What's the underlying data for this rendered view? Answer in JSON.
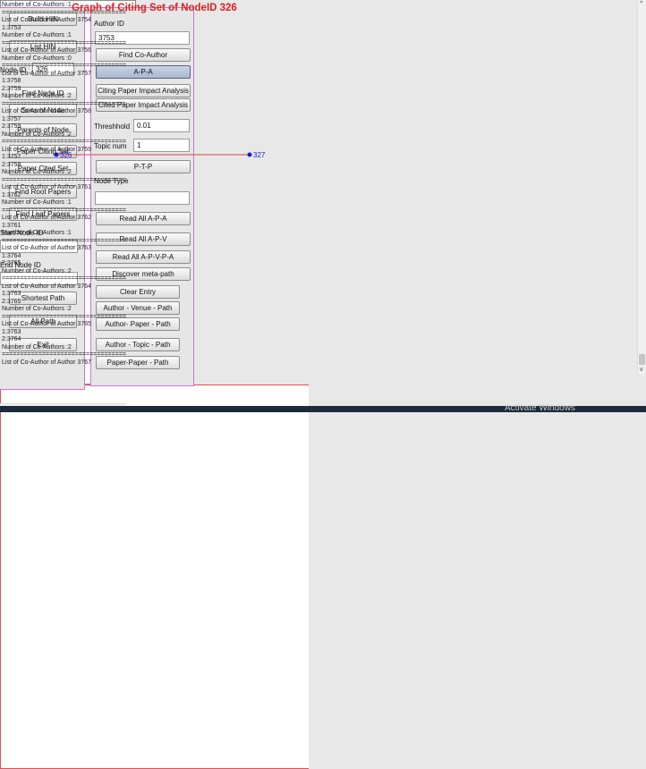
{
  "left_panel": {
    "build_hin": "Build HIN",
    "list_hin": "List HIN",
    "node_id_label": "Node ID",
    "node_id_value": "326",
    "find_node_id": "Find Node ID",
    "sons_of_node": "Sons  of Node",
    "parents_of_node": "Parents of Node",
    "paper_citing_set": "Paper Citing Set",
    "paper_cited_set": "Paper Cited Set",
    "find_root_papers": "Find Root Papers",
    "find_leaf_papers": "Find Leaf Papers",
    "start_node_id_label": "Start Node ID",
    "start_node_id_value": "",
    "end_node_id_label": "End Node ID",
    "end_node_id_value": "",
    "shortest_path": "Shortest Path",
    "all_path": "All Path",
    "exit": "Exit"
  },
  "mid_panel": {
    "author_id_label": "Author ID",
    "author_id_value": "3753",
    "find_co_author": "Find Co-Author",
    "apa": "A-P-A",
    "citing_paper_impact": "Citing Paper Impact Analysis",
    "cited_paper_impact": "Cited Paper Impact Analysis",
    "threshold_label": "Threshhold",
    "threshold_value": "0.01",
    "topic_num_label": "Topic num",
    "topic_num_value": "1",
    "ptp": "P-T-P",
    "node_type_label": "Node Type",
    "node_type_value": "",
    "read_all_apa": "Read All A-P-A",
    "read_all_apv": "Read All A-P-V",
    "read_all_apvpa": "Read All A-P-V-P-A",
    "discover_meta_path": "Discover meta-path",
    "clear_entry": "Clear Entry",
    "author_venue_path": "Author - Venue - Path",
    "author_paper_path": "Author- Paper - Path",
    "author_topic_path": "Author - Topic - Path",
    "paper_paper_path": "Paper-Paper - Path"
  },
  "output_list": {
    "lines": [
      "Number of Co-Authors :1",
      "======================================",
      "List of Co-Author of Author 3754",
      "1:3753",
      "Number of Co-Authors :1",
      "======================================",
      "List of Co-Author of Author 3756",
      "Number of Co-Authors :0",
      "======================================",
      "List of Co-Author of Author 3757",
      "1:3758",
      "2:3759",
      "Number of Co-Authors :2",
      "======================================",
      "List of Co-Author of Author 3758",
      "1:3757",
      "2:3759",
      "Number of Co-Authors :2",
      "======================================",
      "List of Co-Author of Author 3759",
      "1:3757",
      "2:3758",
      "Number of Co-Authors :2",
      "======================================",
      "List of Co-Author of Author 3761",
      "1:3762",
      "Number of Co-Authors :1",
      "======================================",
      "List of Co-Author of Author 3762",
      "1:3761",
      "Number of Co-Authors :1",
      "======================================",
      "List of Co-Author of Author 3763",
      "1:3764",
      "2:3765",
      "Number of Co-Authors :2",
      "======================================",
      "List of Co-Author of Author 3764",
      "1:3763",
      "2:3765",
      "Number of Co-Authors :2",
      "======================================",
      "List of Co-Author of Author 3765",
      "1:3763",
      "2:3764",
      "Number of Co-Authors :2",
      "======================================",
      "List of Co-Author of Author 3767"
    ],
    "arrow_up": "^",
    "arrow_down": "v",
    "arrow_left": "<",
    "arrow_right": ">"
  },
  "graph": {
    "title": "Graph of Citing Set of NodeID 326",
    "nodes": [
      {
        "id": "326",
        "label": "326"
      },
      {
        "id": "327",
        "label": "327"
      }
    ],
    "edge_color": "#e04040",
    "node_color": "#1a1acc",
    "title_color": "#e02020"
  },
  "watermark": "Activate Windows"
}
